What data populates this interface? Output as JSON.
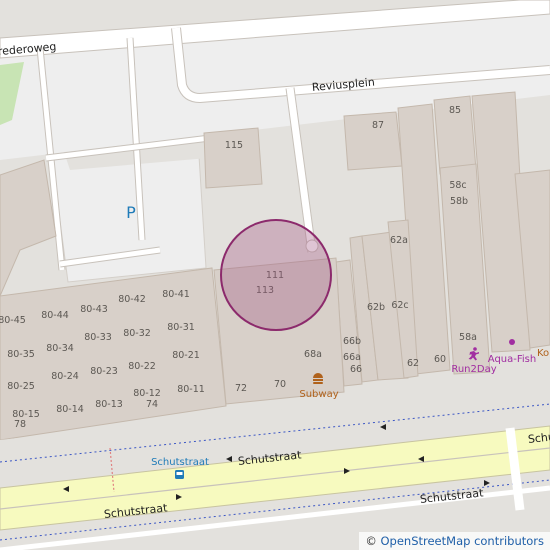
{
  "streets": {
    "frederoweg": "rederoweg",
    "reviusplein": "Reviusplein",
    "schutstraat_main": "Schutstraat",
    "schutstraat_lower": "Schutstraat",
    "schutstraat_right": "Schu",
    "schutstraat_bottom_right": "Schutstraat"
  },
  "parking": {
    "symbol": "P"
  },
  "house_numbers": [
    "115",
    "87",
    "85",
    "58c",
    "58b",
    "62a",
    "111",
    "113",
    "62b",
    "62c",
    "66b",
    "66a",
    "66",
    "68a",
    "62",
    "60",
    "58a",
    "72",
    "70",
    "80-45",
    "80-44",
    "80-43",
    "80-42",
    "80-41",
    "80-33",
    "80-32",
    "80-31",
    "80-35",
    "80-34",
    "80-22",
    "80-21",
    "80-25",
    "80-24",
    "80-23",
    "80-12",
    "80-11",
    "80-15",
    "80-14",
    "80-13",
    "74",
    "78"
  ],
  "pois": {
    "subway": "Subway",
    "run2day": "Run2Day",
    "aqua_fish": "Aqua-Fish",
    "bus_stop": "Schutstraat",
    "edge_label": "Ko"
  },
  "marker": {
    "fill_color": "#a45a84",
    "stroke_color": "#8c2a6c"
  },
  "colors": {
    "background": "#e3e1dd",
    "building": "#d8d0c9",
    "building_outline": "#c4b8ac",
    "road_primary": "#f7fabf",
    "park": "#c8e4b4",
    "footway": "#ffffff"
  },
  "attribution": {
    "symbol": "©",
    "text": "OpenStreetMap contributors"
  }
}
